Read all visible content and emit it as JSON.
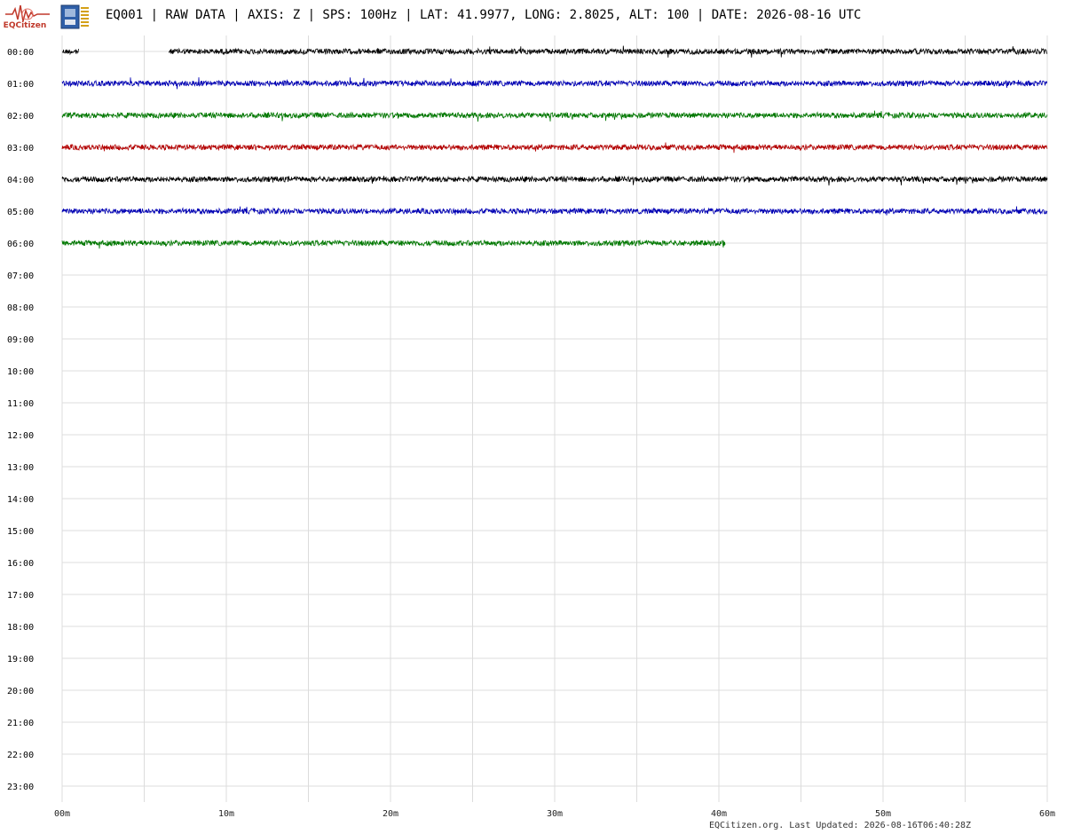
{
  "header": {
    "title": "EQ001 | RAW DATA | AXIS: Z | SPS: 100Hz | LAT: 41.9977, LONG: 2.8025, ALT: 100 | DATE: 2026-08-16 UTC",
    "logo_text": "EQCitizen",
    "logo_icon": "seismograph-logo-icon",
    "device_icon": "sensor-board-icon"
  },
  "footer": {
    "text": "EQCitizen.org. Last Updated: 2026-08-16T06:40:28Z"
  },
  "chart_data": {
    "type": "line",
    "hour_labels": [
      "00:00",
      "01:00",
      "02:00",
      "03:00",
      "04:00",
      "05:00",
      "06:00",
      "07:00",
      "08:00",
      "09:00",
      "10:00",
      "11:00",
      "12:00",
      "13:00",
      "14:00",
      "15:00",
      "16:00",
      "17:00",
      "18:00",
      "19:00",
      "20:00",
      "21:00",
      "22:00",
      "23:00"
    ],
    "x_tick_labels": [
      "00m",
      "10m",
      "20m",
      "30m",
      "40m",
      "50m",
      "60m"
    ],
    "x_ticks": [
      0,
      10,
      20,
      30,
      40,
      50,
      60
    ],
    "xlim": [
      0,
      60
    ],
    "x_grid_step_minutes": 5,
    "grid": true,
    "color_cycle": [
      "#000000",
      "#0000b4",
      "#007800",
      "#b40000"
    ],
    "series": [
      {
        "hour": "00:00",
        "color": "#000000",
        "segments": [
          [
            0,
            1.0
          ],
          [
            6.5,
            60
          ]
        ]
      },
      {
        "hour": "01:00",
        "color": "#0000b4",
        "segments": [
          [
            0,
            60
          ]
        ]
      },
      {
        "hour": "02:00",
        "color": "#007800",
        "segments": [
          [
            0,
            60
          ]
        ]
      },
      {
        "hour": "03:00",
        "color": "#b40000",
        "segments": [
          [
            0,
            60
          ]
        ]
      },
      {
        "hour": "04:00",
        "color": "#000000",
        "segments": [
          [
            0,
            60
          ]
        ]
      },
      {
        "hour": "05:00",
        "color": "#0000b4",
        "segments": [
          [
            0,
            60
          ]
        ]
      },
      {
        "hour": "06:00",
        "color": "#007800",
        "segments": [
          [
            0,
            40.4
          ]
        ]
      }
    ]
  }
}
